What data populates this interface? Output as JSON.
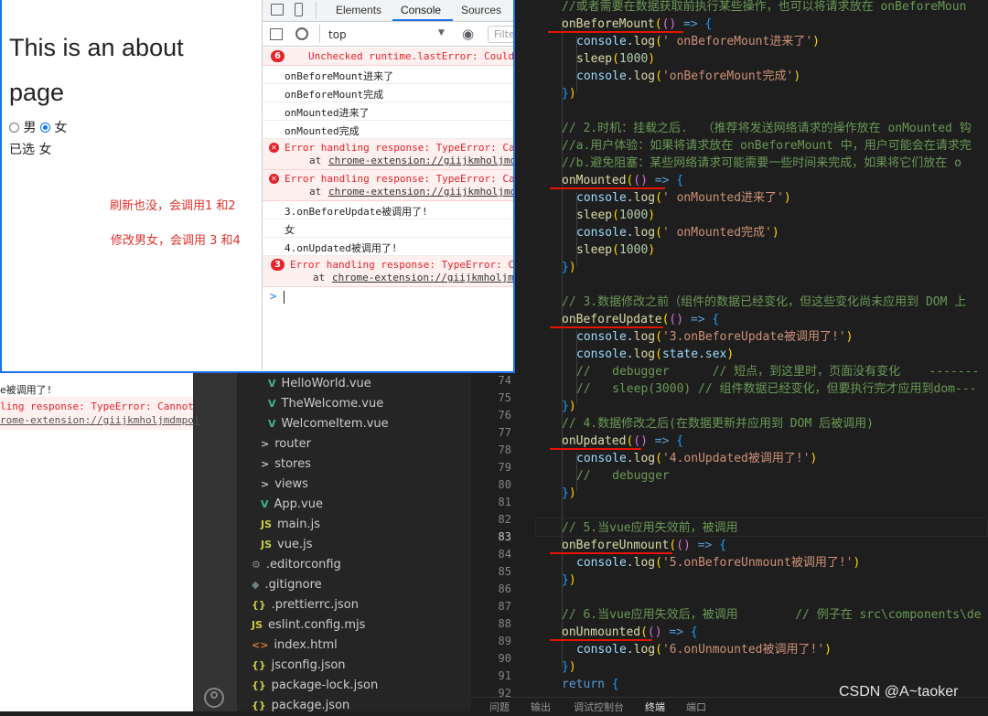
{
  "browser": {
    "page": {
      "title_line1": "This is an about",
      "title_line2": "page",
      "radio_male": "男",
      "radio_female": "女",
      "selected_text": "已选 女",
      "annotation1": "刷新也没，会调用1 和2",
      "annotation2": "修改男女，会调用 3 和4"
    },
    "devtools": {
      "tabs": [
        "Elements",
        "Console",
        "Sources"
      ],
      "active_tab": "Console",
      "context": "top",
      "filter_placeholder": "Filter",
      "error_badge": "6",
      "error_badge2": "3",
      "rows": [
        {
          "type": "error-top",
          "text": "Unchecked runtime.lastError: Could"
        },
        {
          "type": "log",
          "text": "onBeforeMount进来了"
        },
        {
          "type": "log",
          "text": "onBeforeMount完成"
        },
        {
          "type": "log",
          "text": "onMounted进来了"
        },
        {
          "type": "log",
          "text": "onMounted完成"
        },
        {
          "type": "error",
          "text": "Error handling response: TypeError: Can",
          "link": "chrome-extension://giijkmholjmdm",
          "at": "at"
        },
        {
          "type": "error",
          "text": "Error handling response: TypeError: Can",
          "link": "chrome-extension://giijkmholjmdm",
          "at": "at"
        },
        {
          "type": "log",
          "text": "3.onBeforeUpdate被调用了!"
        },
        {
          "type": "log",
          "text": "女"
        },
        {
          "type": "log",
          "text": "4.onUpdated被调用了!"
        },
        {
          "type": "error-count",
          "text": "Error handling response: TypeError: Ca",
          "link": "chrome-extension://giijkmholjm",
          "at": "at"
        }
      ],
      "prompt": ">"
    }
  },
  "fragment": {
    "line1": "e被调用了!",
    "line2": "ling response: TypeError: Cannot",
    "line3": "rome-extension://giijkmholjmdmpoj"
  },
  "explorer": {
    "items": [
      {
        "icon": "V",
        "kind": "vue",
        "label": "HelloWorld.vue"
      },
      {
        "icon": "V",
        "kind": "vue",
        "label": "TheWelcome.vue"
      },
      {
        "icon": "V",
        "kind": "vue",
        "label": "WelcomeItem.vue"
      },
      {
        "icon": ">",
        "kind": "folder",
        "label": "router"
      },
      {
        "icon": ">",
        "kind": "folder",
        "label": "stores"
      },
      {
        "icon": ">",
        "kind": "folder",
        "label": "views"
      },
      {
        "icon": "V",
        "kind": "vue",
        "label": "App.vue"
      },
      {
        "icon": "JS",
        "kind": "js",
        "label": "main.js"
      },
      {
        "icon": "JS",
        "kind": "js",
        "label": "vue.js"
      },
      {
        "icon": "⚙",
        "kind": "cfg",
        "label": ".editorconfig"
      },
      {
        "icon": "◆",
        "kind": "git",
        "label": ".gitignore"
      },
      {
        "icon": "{}",
        "kind": "json",
        "label": ".prettierrc.json"
      },
      {
        "icon": "JS",
        "kind": "js",
        "label": "eslint.config.mjs"
      },
      {
        "icon": "<>",
        "kind": "html",
        "label": "index.html"
      },
      {
        "icon": "{}",
        "kind": "json",
        "label": "jsconfig.json"
      },
      {
        "icon": "{}",
        "kind": "json",
        "label": "package-lock.json"
      },
      {
        "icon": "{}",
        "kind": "json",
        "label": "package.json"
      }
    ]
  },
  "editor": {
    "line_numbers": [
      "74",
      "75",
      "76",
      "77",
      "78",
      "79",
      "80",
      "81",
      "82",
      "83",
      "84",
      "85",
      "86",
      "87",
      "88",
      "89",
      "90",
      "91",
      "92"
    ],
    "active_line": "83",
    "code": {
      "l0": "//或者需要在数据获取前执行某些操作，也可以将请求放在 onBeforeMoun",
      "l1_fn": "onBeforeMount",
      "l1_rest": "(() => {",
      "l2": "console.log(' onBeforeMount进来了')",
      "l3": "sleep(1000)",
      "l4": "console.log('onBeforeMount完成')",
      "l5": "})",
      "l7": "// 2.时机：挂载之后.  （推荐将发送网络请求的操作放在 onMounted 钩",
      "l8": "//a.用户体验：如果将请求放在 onBeforeMount 中，用户可能会在请求完",
      "l9": "//b.避免阻塞：某些网络请求可能需要一些时间来完成，如果将它们放在 o",
      "l10_fn": "onMounted",
      "l11": "console.log(' onMounted进来了')",
      "l12": "sleep(1000)",
      "l13": "console.log(' onMounted完成')",
      "l14": "sleep(1000)",
      "l15": "})",
      "l17": "// 3.数据修改之前（组件的数据已经变化，但这些变化尚未应用到 DOM 上",
      "l18_fn": "onBeforeUpdate",
      "l19": "console.log('3.onBeforeUpdate被调用了!')",
      "l20": "console.log(state.sex)",
      "l21": "//   debugger      // 短点，到这里时，页面没有变化    -------",
      "l22": "//   sleep(3000) // 组件数据已经变化，但要执行完才应用到dom---",
      "l23": "})",
      "l24": "// 4.数据修改之后(在数据更新并应用到 DOM 后被调用)",
      "l25_fn": "onUpdated",
      "l26": "console.log('4.onUpdated被调用了!')",
      "l27": "//   debugger",
      "l28": "})",
      "l30": "// 5.当vue应用失效前，被调用",
      "l31_fn": "onBeforeUnmount",
      "l32": "console.log('5.onBeforeUnmount被调用了!')",
      "l33": "})",
      "l35": "// 6.当vue应用失效后，被调用        // 例子在 src\\components\\de",
      "l36_fn": "onUnmounted",
      "l37": "console.log('6.onUnmounted被调用了!')",
      "l38": "})",
      "l39": "return {"
    }
  },
  "bottom_tabs": [
    "问题",
    "输出",
    "调试控制台",
    "终端",
    "端口"
  ],
  "bottom_active": "终端",
  "watermark": "CSDN @A~taoker"
}
